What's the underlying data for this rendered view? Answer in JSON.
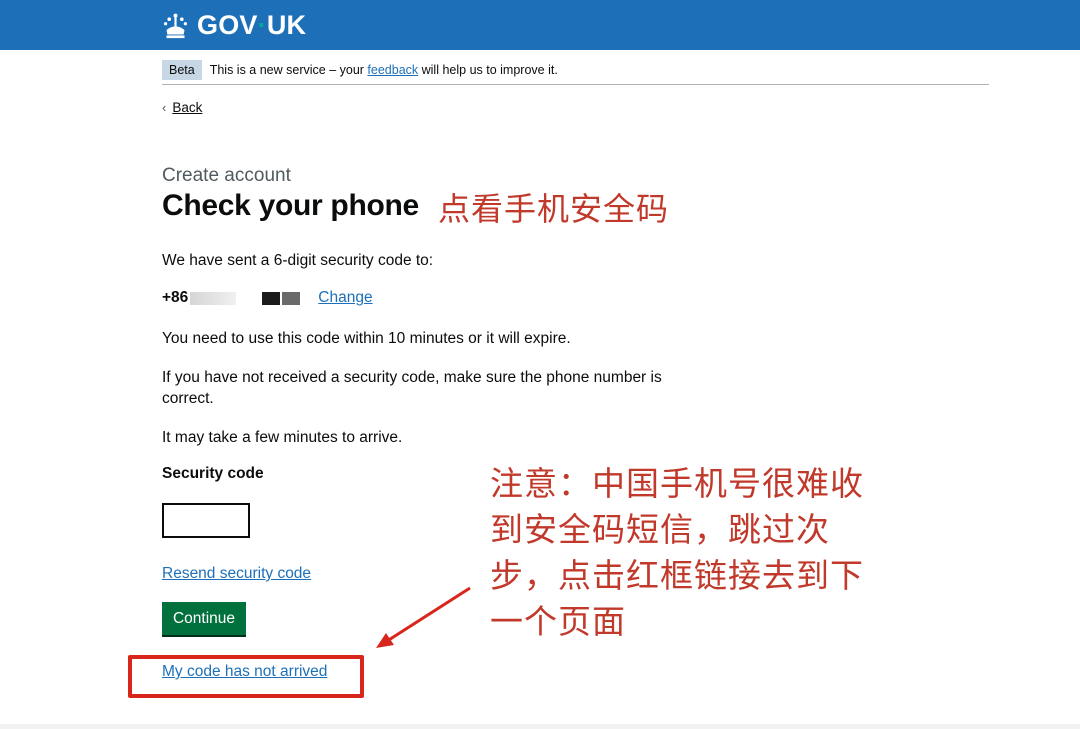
{
  "header": {
    "logo_text_left": "GOV",
    "logo_dot": "·",
    "logo_text_right": "UK",
    "brand_color": "#1d70b8",
    "crown_icon": "crown-icon"
  },
  "phase_banner": {
    "tag": "Beta",
    "text_before": "This is a new service – your ",
    "link": "feedback",
    "text_after": " will help us to improve it."
  },
  "nav": {
    "back_icon": "chevron-left-icon",
    "back_label": "Back"
  },
  "main": {
    "caption": "Create account",
    "title": "Check your phone",
    "sent_text": "We have sent a 6-digit security code to:",
    "phone_prefix": "+86",
    "change_link": "Change",
    "expiry_text": "You need to use this code within 10 minutes or it will expire.",
    "not_received_text": "If you have not received a security code, make sure the phone number is correct.",
    "arrive_text": "It may take a few minutes to arrive.",
    "code_label": "Security code",
    "code_value": "",
    "resend_link": "Resend security code",
    "continue_button": "Continue",
    "not_arrived_link": "My code has not arrived"
  },
  "annotations": {
    "title_note": "点看手机安全码",
    "main_note": "注意：中国手机号很难收到安全码短信，跳过次步，点击红框链接去到下一个页面",
    "highlight_color": "#d9261c",
    "text_color": "#c0392b"
  }
}
